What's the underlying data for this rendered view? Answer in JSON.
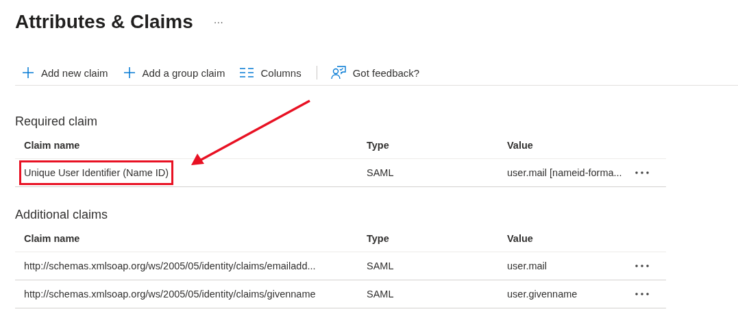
{
  "page": {
    "title": "Attributes & Claims",
    "more": "···"
  },
  "toolbar": [
    {
      "kind": "plus",
      "label": "Add new claim"
    },
    {
      "kind": "plus",
      "label": "Add a group claim"
    },
    {
      "kind": "columns",
      "label": "Columns"
    },
    {
      "kind": "feedback",
      "label": "Got feedback?"
    }
  ],
  "sections": [
    {
      "title": "Required claim",
      "columns": [
        "Claim name",
        "Type",
        "Value"
      ],
      "rows": [
        {
          "claim_name": "Unique User Identifier (Name ID)",
          "type": "SAML",
          "value": "user.mail [nameid-forma...",
          "highlighted": true
        }
      ]
    },
    {
      "title": "Additional claims",
      "columns": [
        "Claim name",
        "Type",
        "Value"
      ],
      "rows": [
        {
          "claim_name": "http://schemas.xmlsoap.org/ws/2005/05/identity/claims/emailadd...",
          "type": "SAML",
          "value": "user.mail",
          "highlighted": false
        },
        {
          "claim_name": "http://schemas.xmlsoap.org/ws/2005/05/identity/claims/givenname",
          "type": "SAML",
          "value": "user.givenname",
          "highlighted": false
        }
      ]
    }
  ]
}
